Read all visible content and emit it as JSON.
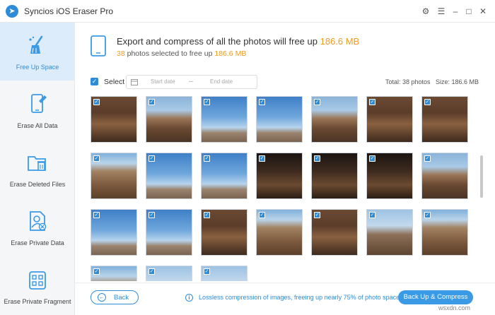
{
  "window": {
    "title": "Syncios iOS Eraser Pro"
  },
  "sidebar": {
    "items": [
      {
        "label": "Free Up Space",
        "icon": "broom-icon",
        "active": true
      },
      {
        "label": "Erase All Data",
        "icon": "phone-erase-icon",
        "active": false
      },
      {
        "label": "Erase Deleted Files",
        "icon": "folder-trash-icon",
        "active": false
      },
      {
        "label": "Erase Private Data",
        "icon": "private-user-icon",
        "active": false
      },
      {
        "label": "Erase Private Fragment",
        "icon": "fragment-grid-icon",
        "active": false
      }
    ]
  },
  "header": {
    "title_prefix": "Export and compress of all the photos will free up",
    "title_size": "186.6 MB",
    "sub_count": "38",
    "sub_mid": "photos selected to free up",
    "sub_size": "186.6 MB"
  },
  "toolbar": {
    "select_label": "Select",
    "start_placeholder": "Start date",
    "separator": "--",
    "end_placeholder": "End date",
    "total_photos": "Total: 38 photos",
    "total_size": "Size: 186.6 MB"
  },
  "photos": [
    {
      "style": "a",
      "checked": true
    },
    {
      "style": "b",
      "checked": true
    },
    {
      "style": "c",
      "checked": true
    },
    {
      "style": "c",
      "checked": true
    },
    {
      "style": "b",
      "checked": true
    },
    {
      "style": "a",
      "checked": true
    },
    {
      "style": "a",
      "checked": true
    },
    {
      "style": "e",
      "checked": true
    },
    {
      "style": "c",
      "checked": true
    },
    {
      "style": "c",
      "checked": true
    },
    {
      "style": "d",
      "checked": true
    },
    {
      "style": "d",
      "checked": true
    },
    {
      "style": "d",
      "checked": true
    },
    {
      "style": "b",
      "checked": true
    },
    {
      "style": "c",
      "checked": true
    },
    {
      "style": "c",
      "checked": true
    },
    {
      "style": "a",
      "checked": true
    },
    {
      "style": "e",
      "checked": true
    },
    {
      "style": "a",
      "checked": true
    },
    {
      "style": "f",
      "checked": true
    },
    {
      "style": "e",
      "checked": true
    },
    {
      "style": "e",
      "checked": true
    },
    {
      "style": "f",
      "checked": true
    },
    {
      "style": "f",
      "checked": true
    }
  ],
  "footer": {
    "back_label": "Back",
    "info_text": "Lossless compression of images, freeing up nearly 75% of photo space",
    "compress_label": "Back Up & Compress",
    "watermark": "wsxdn.com"
  },
  "colors": {
    "accent": "#2e8bd8",
    "highlight": "#f39a1e",
    "button": "#3b9ae6"
  }
}
